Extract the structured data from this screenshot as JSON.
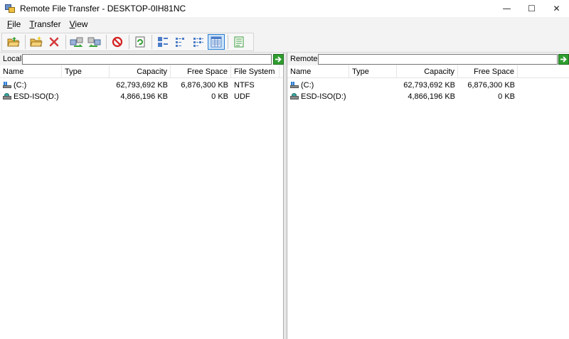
{
  "window": {
    "title": "Remote File Transfer - DESKTOP-0IH81NC",
    "minimize": "—",
    "maximize": "☐",
    "close": "✕"
  },
  "menu": [
    {
      "label_u": "F",
      "label_rest": "ile"
    },
    {
      "label_u": "T",
      "label_rest": "ransfer"
    },
    {
      "label_u": "V",
      "label_rest": "iew"
    }
  ],
  "toolbar": {
    "icons": [
      "open-folder-icon",
      "new-folder-icon",
      "delete-icon",
      "upload-icon",
      "download-icon",
      "stop-icon",
      "refresh-icon",
      "large-icons-view-icon",
      "small-icons-view-icon",
      "list-view-icon",
      "details-view-icon",
      "properties-icon"
    ],
    "active": "details-view-icon"
  },
  "local": {
    "label": "Local",
    "path": "",
    "columns": [
      "Name",
      "Type",
      "Capacity",
      "Free Space",
      "File System"
    ],
    "rows": [
      {
        "icon": "hard-drive-icon",
        "name": "(C:)",
        "type": "",
        "capacity": "62,793,692 KB",
        "free": "6,876,300 KB",
        "fs": "NTFS"
      },
      {
        "icon": "cd-drive-icon",
        "name": "ESD-ISO(D:)",
        "type": "",
        "capacity": "4,866,196 KB",
        "free": "0 KB",
        "fs": "UDF"
      }
    ]
  },
  "remote": {
    "label": "Remote",
    "path": "",
    "columns": [
      "Name",
      "Type",
      "Capacity",
      "Free Space"
    ],
    "rows": [
      {
        "icon": "hard-drive-icon",
        "name": "(C:)",
        "type": "",
        "capacity": "62,793,692 KB",
        "free": "6,876,300 KB"
      },
      {
        "icon": "cd-drive-icon",
        "name": "ESD-ISO(D:)",
        "type": "",
        "capacity": "4,866,196 KB",
        "free": "0 KB"
      }
    ]
  },
  "colors": {
    "accent": "#2b7cd3",
    "go": "#2f9e2f",
    "stop": "#d42020"
  }
}
